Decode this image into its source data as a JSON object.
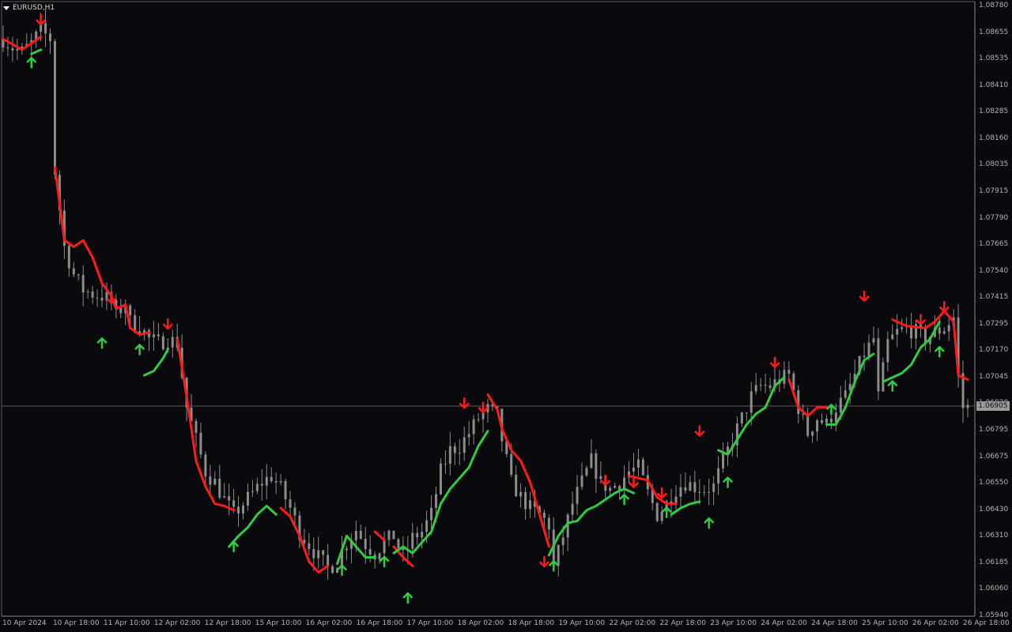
{
  "window": {
    "title": "EURUSD,H1"
  },
  "price_axis": {
    "labels": [
      "1.08780",
      "1.08655",
      "1.08535",
      "1.08410",
      "1.08285",
      "1.08160",
      "1.08035",
      "1.07915",
      "1.07790",
      "1.07665",
      "1.07540",
      "1.07415",
      "1.07295",
      "1.07170",
      "1.07045",
      "1.06920",
      "1.06795",
      "1.06675",
      "1.06550",
      "1.06430",
      "1.06310",
      "1.06185",
      "1.06060",
      "1.05940"
    ],
    "current_price": "1.06905"
  },
  "time_axis": {
    "labels": [
      "10 Apr 2024",
      "10 Apr 18:00",
      "11 Apr 10:00",
      "12 Apr 02:00",
      "12 Apr 18:00",
      "15 Apr 10:00",
      "16 Apr 02:00",
      "16 Apr 18:00",
      "17 Apr 10:00",
      "18 Apr 02:00",
      "18 Apr 18:00",
      "19 Apr 10:00",
      "22 Apr 02:00",
      "22 Apr 18:00",
      "23 Apr 10:00",
      "24 Apr 02:00",
      "24 Apr 18:00",
      "25 Apr 10:00",
      "26 Apr 02:00",
      "26 Apr 18:00"
    ]
  },
  "colors": {
    "background": "#0a0a0e",
    "candles": "#8c8c8c",
    "down_line": "#ff1a1a",
    "up_line": "#2ecc40",
    "grid_line": "#5a5a5a",
    "axis_text": "#b4b4b4"
  },
  "chart_data": {
    "type": "candlestick",
    "symbol": "EURUSD",
    "timeframe": "H1",
    "ylim": [
      1.0594,
      1.0878
    ],
    "current_price": 1.06905,
    "close_path": [
      [
        0,
        1.0862
      ],
      [
        2,
        1.0858
      ],
      [
        4,
        1.0856
      ],
      [
        6,
        1.086
      ],
      [
        8,
        1.0866
      ],
      [
        10,
        1.0862
      ],
      [
        11,
        1.08
      ],
      [
        13,
        1.0765
      ],
      [
        15,
        1.0752
      ],
      [
        17,
        1.0745
      ],
      [
        19,
        1.0743
      ],
      [
        21,
        1.0742
      ],
      [
        23,
        1.074
      ],
      [
        24,
        1.0733
      ],
      [
        26,
        1.0739
      ],
      [
        27,
        1.073
      ],
      [
        29,
        1.0728
      ],
      [
        31,
        1.0722
      ],
      [
        33,
        1.072
      ],
      [
        35,
        1.0722
      ],
      [
        37,
        1.072
      ],
      [
        38,
        1.0705
      ],
      [
        39,
        1.069
      ],
      [
        41,
        1.0675
      ],
      [
        43,
        1.066
      ],
      [
        45,
        1.0655
      ],
      [
        47,
        1.0647
      ],
      [
        49,
        1.064
      ],
      [
        51,
        1.0645
      ],
      [
        53,
        1.065
      ],
      [
        55,
        1.0655
      ],
      [
        57,
        1.0658
      ],
      [
        59,
        1.0652
      ],
      [
        61,
        1.0643
      ],
      [
        63,
        1.0632
      ],
      [
        65,
        1.0626
      ],
      [
        67,
        1.062
      ],
      [
        69,
        1.0615
      ],
      [
        71,
        1.0618
      ],
      [
        73,
        1.0627
      ],
      [
        75,
        1.0633
      ],
      [
        77,
        1.0626
      ],
      [
        79,
        1.0622
      ],
      [
        81,
        1.0627
      ],
      [
        83,
        1.063
      ],
      [
        85,
        1.062
      ],
      [
        87,
        1.0629
      ],
      [
        89,
        1.0632
      ],
      [
        91,
        1.064
      ],
      [
        93,
        1.066
      ],
      [
        95,
        1.067
      ],
      [
        97,
        1.0672
      ],
      [
        99,
        1.0678
      ],
      [
        101,
        1.0685
      ],
      [
        103,
        1.0689
      ],
      [
        105,
        1.0686
      ],
      [
        106,
        1.0675
      ],
      [
        108,
        1.0655
      ],
      [
        110,
        1.0648
      ],
      [
        112,
        1.0643
      ],
      [
        114,
        1.064
      ],
      [
        116,
        1.0635
      ],
      [
        117,
        1.0615
      ],
      [
        119,
        1.063
      ],
      [
        121,
        1.0645
      ],
      [
        123,
        1.0655
      ],
      [
        125,
        1.0665
      ],
      [
        127,
        1.0655
      ],
      [
        129,
        1.0652
      ],
      [
        131,
        1.0655
      ],
      [
        133,
        1.066
      ],
      [
        135,
        1.0662
      ],
      [
        137,
        1.065
      ],
      [
        139,
        1.064
      ],
      [
        141,
        1.0645
      ],
      [
        143,
        1.0652
      ],
      [
        145,
        1.0655
      ],
      [
        147,
        1.0653
      ],
      [
        149,
        1.0652
      ],
      [
        151,
        1.0653
      ],
      [
        153,
        1.0665
      ],
      [
        155,
        1.0675
      ],
      [
        157,
        1.0685
      ],
      [
        159,
        1.0695
      ],
      [
        161,
        1.07
      ],
      [
        163,
        1.07
      ],
      [
        165,
        1.0703
      ],
      [
        167,
        1.0705
      ],
      [
        169,
        1.069
      ],
      [
        171,
        1.0678
      ],
      [
        173,
        1.0685
      ],
      [
        175,
        1.0682
      ],
      [
        177,
        1.069
      ],
      [
        179,
        1.0695
      ],
      [
        181,
        1.0705
      ],
      [
        183,
        1.0715
      ],
      [
        185,
        1.0722
      ],
      [
        186,
        1.0695
      ],
      [
        188,
        1.072
      ],
      [
        190,
        1.0725
      ],
      [
        192,
        1.0727
      ],
      [
        194,
        1.0725
      ],
      [
        196,
        1.0722
      ],
      [
        198,
        1.0725
      ],
      [
        200,
        1.0727
      ],
      [
        202,
        1.0732
      ],
      [
        203,
        1.0705
      ],
      [
        204,
        1.069
      ]
    ],
    "down_line": [
      [
        [
          0,
          1.0862
        ],
        [
          4,
          1.0857
        ],
        [
          8,
          1.0863
        ]
      ],
      [
        [
          11,
          1.0802
        ],
        [
          13,
          1.0768
        ],
        [
          15,
          1.0765
        ],
        [
          17,
          1.0768
        ],
        [
          19,
          1.076
        ],
        [
          21,
          1.0748
        ],
        [
          23,
          1.0742
        ],
        [
          24,
          1.0736
        ],
        [
          26,
          1.0738
        ],
        [
          27,
          1.0727
        ],
        [
          29,
          1.0724
        ],
        [
          31,
          1.0725
        ]
      ],
      [
        [
          37,
          1.0722
        ],
        [
          39,
          1.0695
        ],
        [
          41,
          1.0665
        ],
        [
          43,
          1.0653
        ],
        [
          45,
          1.0645
        ],
        [
          47,
          1.0644
        ],
        [
          49,
          1.0642
        ]
      ],
      [
        [
          59,
          1.0643
        ],
        [
          61,
          1.0639
        ],
        [
          63,
          1.063
        ],
        [
          65,
          1.0618
        ],
        [
          67,
          1.0613
        ],
        [
          69,
          1.0616
        ]
      ],
      [
        [
          79,
          1.0632
        ],
        [
          81,
          1.0628
        ]
      ],
      [
        [
          83,
          1.0625
        ],
        [
          85,
          1.062
        ],
        [
          87,
          1.0616
        ]
      ],
      [
        [
          103,
          1.0696
        ],
        [
          105,
          1.0689
        ],
        [
          106,
          1.068
        ],
        [
          108,
          1.067
        ],
        [
          110,
          1.0665
        ],
        [
          112,
          1.0655
        ],
        [
          114,
          1.064
        ],
        [
          116,
          1.0625
        ]
      ],
      [
        [
          133,
          1.0658
        ],
        [
          135,
          1.0657
        ],
        [
          137,
          1.0656
        ],
        [
          139,
          1.0648
        ]
      ],
      [
        [
          139,
          1.0648
        ],
        [
          141,
          1.0645
        ],
        [
          143,
          1.0645
        ]
      ],
      [
        [
          167,
          1.0703
        ],
        [
          169,
          1.069
        ],
        [
          171,
          1.0686
        ],
        [
          173,
          1.069
        ],
        [
          175,
          1.069
        ]
      ],
      [
        [
          189,
          1.0731
        ],
        [
          192,
          1.0728
        ],
        [
          196,
          1.0727
        ],
        [
          198,
          1.073
        ],
        [
          200,
          1.0735
        ],
        [
          202,
          1.073
        ],
        [
          203,
          1.0705
        ],
        [
          205,
          1.0703
        ]
      ]
    ],
    "up_line": [
      [
        [
          6,
          1.0855
        ],
        [
          8,
          1.0857
        ]
      ],
      [
        [
          30,
          1.0705
        ],
        [
          32,
          1.0707
        ],
        [
          34,
          1.0713
        ],
        [
          35,
          1.0717
        ]
      ],
      [
        [
          48,
          1.0625
        ],
        [
          50,
          1.063
        ],
        [
          52,
          1.0634
        ],
        [
          54,
          1.064
        ],
        [
          56,
          1.0644
        ],
        [
          58,
          1.064
        ]
      ],
      [
        [
          71,
          1.0617
        ],
        [
          73,
          1.063
        ],
        [
          75,
          1.0625
        ],
        [
          77,
          1.062
        ],
        [
          79,
          1.062
        ]
      ],
      [
        [
          83,
          1.0622
        ],
        [
          85,
          1.0625
        ],
        [
          87,
          1.0622
        ],
        [
          89,
          1.0627
        ],
        [
          91,
          1.0632
        ],
        [
          93,
          1.0645
        ],
        [
          95,
          1.0652
        ],
        [
          97,
          1.0657
        ],
        [
          99,
          1.0662
        ],
        [
          101,
          1.0672
        ],
        [
          103,
          1.0679
        ]
      ],
      [
        [
          116,
          1.0621
        ],
        [
          118,
          1.063
        ],
        [
          120,
          1.0636
        ],
        [
          122,
          1.0637
        ],
        [
          124,
          1.0642
        ],
        [
          126,
          1.0644
        ],
        [
          128,
          1.0647
        ],
        [
          130,
          1.065
        ],
        [
          132,
          1.0652
        ],
        [
          134,
          1.065
        ]
      ],
      [
        [
          142,
          1.064
        ],
        [
          144,
          1.0643
        ],
        [
          146,
          1.0645
        ],
        [
          148,
          1.0646
        ]
      ],
      [
        [
          152,
          1.067
        ],
        [
          154,
          1.0668
        ],
        [
          156,
          1.0675
        ],
        [
          158,
          1.0682
        ],
        [
          160,
          1.0687
        ],
        [
          162,
          1.069
        ],
        [
          164,
          1.07
        ],
        [
          166,
          1.0704
        ]
      ],
      [
        [
          175,
          1.0682
        ],
        [
          177,
          1.0682
        ],
        [
          179,
          1.069
        ],
        [
          181,
          1.0702
        ],
        [
          183,
          1.0712
        ],
        [
          185,
          1.0715
        ]
      ],
      [
        [
          187,
          1.0702
        ],
        [
          189,
          1.0704
        ],
        [
          191,
          1.0706
        ],
        [
          193,
          1.071
        ],
        [
          195,
          1.0718
        ],
        [
          197,
          1.0722
        ],
        [
          199,
          1.073
        ]
      ]
    ],
    "down_arrows": [
      [
        8,
        1.0871
      ],
      [
        23,
        1.0741
      ],
      [
        35,
        1.0729
      ],
      [
        98,
        1.0692
      ],
      [
        102,
        1.069
      ],
      [
        115,
        1.0618
      ],
      [
        128,
        1.0656
      ],
      [
        134,
        1.0655
      ],
      [
        140,
        1.065
      ],
      [
        148,
        1.0679
      ],
      [
        164,
        1.0711
      ],
      [
        183,
        1.0742
      ],
      [
        195,
        1.0731
      ],
      [
        200,
        1.0737
      ]
    ],
    "up_arrows": [
      [
        6,
        1.0851
      ],
      [
        21,
        1.072
      ],
      [
        29,
        1.0717
      ],
      [
        49,
        1.0625
      ],
      [
        72,
        1.0614
      ],
      [
        81,
        1.0618
      ],
      [
        86,
        1.0601
      ],
      [
        117,
        1.0616
      ],
      [
        132,
        1.0647
      ],
      [
        141,
        1.0641
      ],
      [
        150,
        1.0636
      ],
      [
        154,
        1.0655
      ],
      [
        176,
        1.0689
      ],
      [
        189,
        1.07
      ],
      [
        199,
        1.0716
      ]
    ]
  }
}
